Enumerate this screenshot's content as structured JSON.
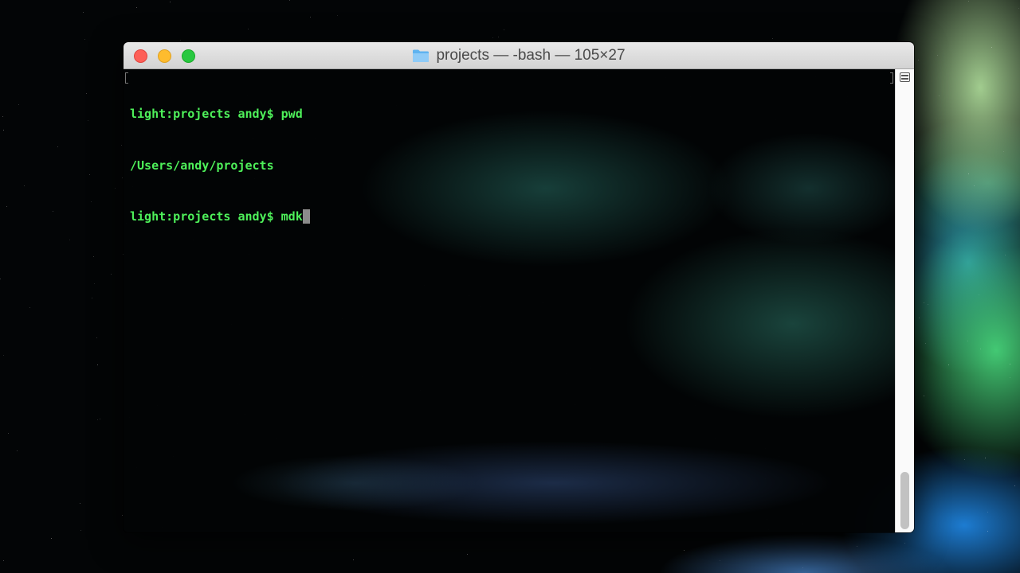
{
  "window": {
    "title": "projects — -bash — 105×27",
    "folder_icon": "folder-icon"
  },
  "terminal": {
    "lines": [
      "light:projects andy$ pwd",
      "/Users/andy/projects",
      "light:projects andy$ mdk"
    ],
    "text_color": "#4ef05a",
    "cursor_color": "#8b8b8b"
  },
  "colors": {
    "close": "#fd5f57",
    "minimize": "#febc2e",
    "zoom": "#28c840"
  }
}
